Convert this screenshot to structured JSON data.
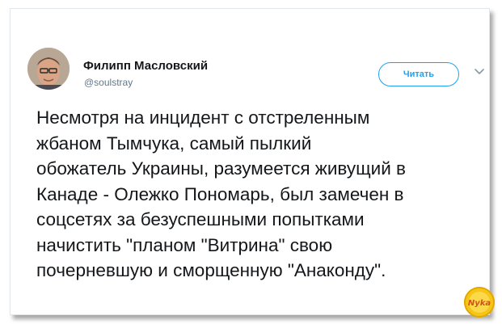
{
  "tweet": {
    "author_name": "Филипп Масловский",
    "author_handle": "@soulstray",
    "follow_label": "Читать",
    "text": "Несмотря на инцидент с отстреленным\nжбаном Тымчука, самый пылкий\nобожатель Украины, разумеется живущий в\nКанаде - Олежко Пономарь, был замечен в\nсоцсетях за безуспешными попытками\nначистить \"планом \"Витрина\" свою\nпочерневшую и сморщенную \"Анаконду\"."
  },
  "icons": {
    "menu": "chevron-down-icon",
    "avatar": "avatar",
    "watermark": "logo-watermark"
  },
  "colors": {
    "accent": "#1da1f2",
    "text": "#14171a",
    "secondary_text": "#657786",
    "watermark": "#f5c518"
  },
  "watermark_text": "Nyka"
}
